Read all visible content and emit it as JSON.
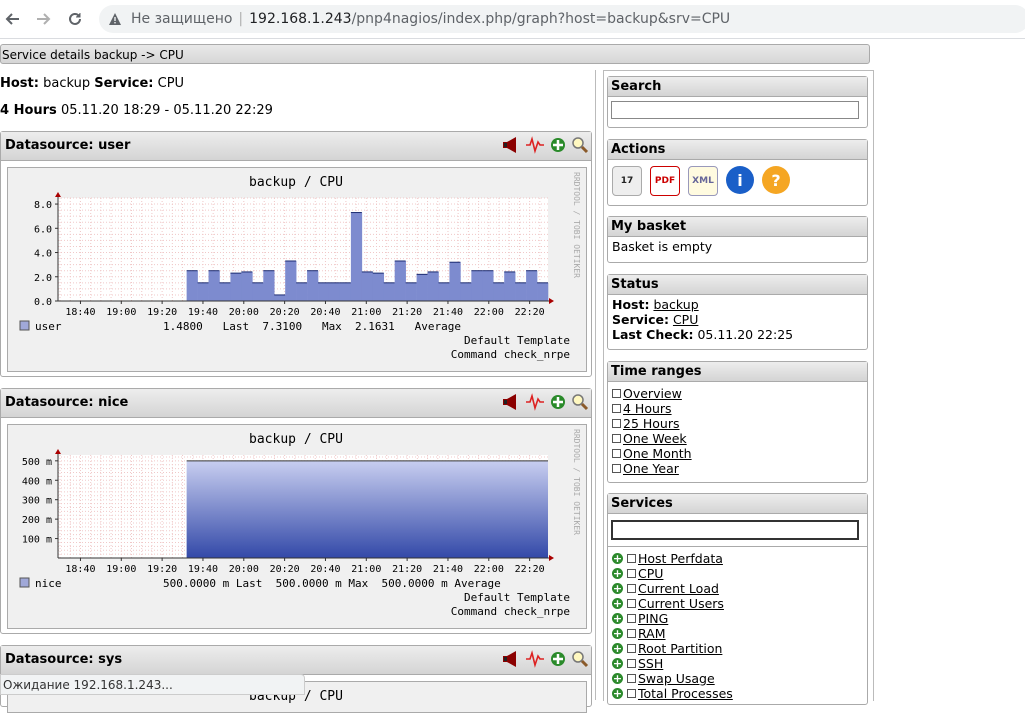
{
  "browser": {
    "security_label": "Не защищено",
    "url_host": "192.168.1.243",
    "url_path": "/pnp4nagios/index.php/graph?host=backup&srv=CPU",
    "status_text": "Ожидание 192.168.1.243..."
  },
  "page": {
    "header": "Service details backup -> CPU",
    "host_label": "Host:",
    "host_value": "backup",
    "service_label": "Service:",
    "service_value": "CPU",
    "period_label": "4 Hours",
    "period_range": "05.11.20 18:29 - 05.11.20 22:29"
  },
  "datasources": [
    {
      "title": "Datasource: user",
      "graph_title": "backup / CPU",
      "legend_name": "user",
      "legend_values": "1.4800   Last  7.3100   Max  2.1631   Average",
      "template": "Default Template",
      "command": "Command check_nrpe"
    },
    {
      "title": "Datasource: nice",
      "graph_title": "backup / CPU",
      "legend_name": "nice",
      "legend_values": "500.0000 m Last  500.0000 m Max  500.0000 m Average",
      "template": "Default Template",
      "command": "Command check_nrpe"
    },
    {
      "title": "Datasource: sys",
      "graph_title": "backup / CPU"
    }
  ],
  "rrd_watermark": "RRDTOOL / TOBI OETIKER",
  "chart_data": [
    {
      "type": "area",
      "title": "backup / CPU",
      "x_ticks": [
        "18:40",
        "19:00",
        "19:20",
        "19:40",
        "20:00",
        "20:20",
        "20:40",
        "21:00",
        "21:20",
        "21:40",
        "22:00",
        "22:20"
      ],
      "y_ticks": [
        "0.0",
        "2.0",
        "4.0",
        "6.0",
        "8.0"
      ],
      "ylim": [
        0,
        8.5
      ],
      "x_range": [
        "18:29",
        "22:29"
      ],
      "series": [
        {
          "name": "user",
          "color": "#4a5fb0",
          "values": [
            2.5,
            1.5,
            2.5,
            1.5,
            2.3,
            2.4,
            1.5,
            2.5,
            0.5,
            3.3,
            1.5,
            2.5,
            1.5,
            1.5,
            1.5,
            7.3,
            2.4,
            2.3,
            1.5,
            3.3,
            1.5,
            2.2,
            2.4,
            1.5,
            3.2,
            1.5,
            2.5,
            2.5,
            1.5,
            2.4,
            1.5,
            2.5,
            1.5
          ]
        }
      ],
      "series_start": "19:32",
      "grid": true
    },
    {
      "type": "area",
      "title": "backup / CPU",
      "x_ticks": [
        "18:40",
        "19:00",
        "19:20",
        "19:40",
        "20:00",
        "20:20",
        "20:40",
        "21:00",
        "21:20",
        "21:40",
        "22:00",
        "22:20"
      ],
      "y_ticks": [
        "100 m",
        "200 m",
        "300 m",
        "400 m",
        "500 m"
      ],
      "ylim": [
        0,
        0.53
      ],
      "x_range": [
        "18:29",
        "22:29"
      ],
      "series": [
        {
          "name": "nice",
          "color": "#4a5fb0",
          "values": [
            0.5
          ]
        }
      ],
      "series_start": "19:32",
      "grid": true
    }
  ],
  "sidebar": {
    "search_title": "Search",
    "actions_title": "Actions",
    "actions": [
      {
        "icon": "calendar-icon",
        "label": "17"
      },
      {
        "icon": "pdf-icon",
        "label": "PDF"
      },
      {
        "icon": "xml-icon",
        "label": "XML"
      },
      {
        "icon": "info-icon",
        "label": "i"
      },
      {
        "icon": "help-icon",
        "label": "?"
      }
    ],
    "basket_title": "My basket",
    "basket_text": "Basket is empty",
    "status_title": "Status",
    "status_host_label": "Host:",
    "status_host": "backup",
    "status_service_label": "Service:",
    "status_service": "CPU",
    "status_check_label": "Last Check:",
    "status_check": "05.11.20 22:25",
    "timeranges_title": "Time ranges",
    "timeranges": [
      "Overview",
      "4 Hours",
      "25 Hours",
      "One Week",
      "One Month",
      "One Year"
    ],
    "services_title": "Services",
    "services": [
      "Host Perfdata",
      "CPU",
      "Current Load",
      "Current Users",
      "PING",
      "RAM",
      "Root Partition",
      "SSH",
      "Swap Usage",
      "Total Processes"
    ]
  },
  "colors": {
    "accent": "#4a5fb0",
    "grid": "#e6a0a0",
    "header_grad": "#d4d4d4"
  }
}
